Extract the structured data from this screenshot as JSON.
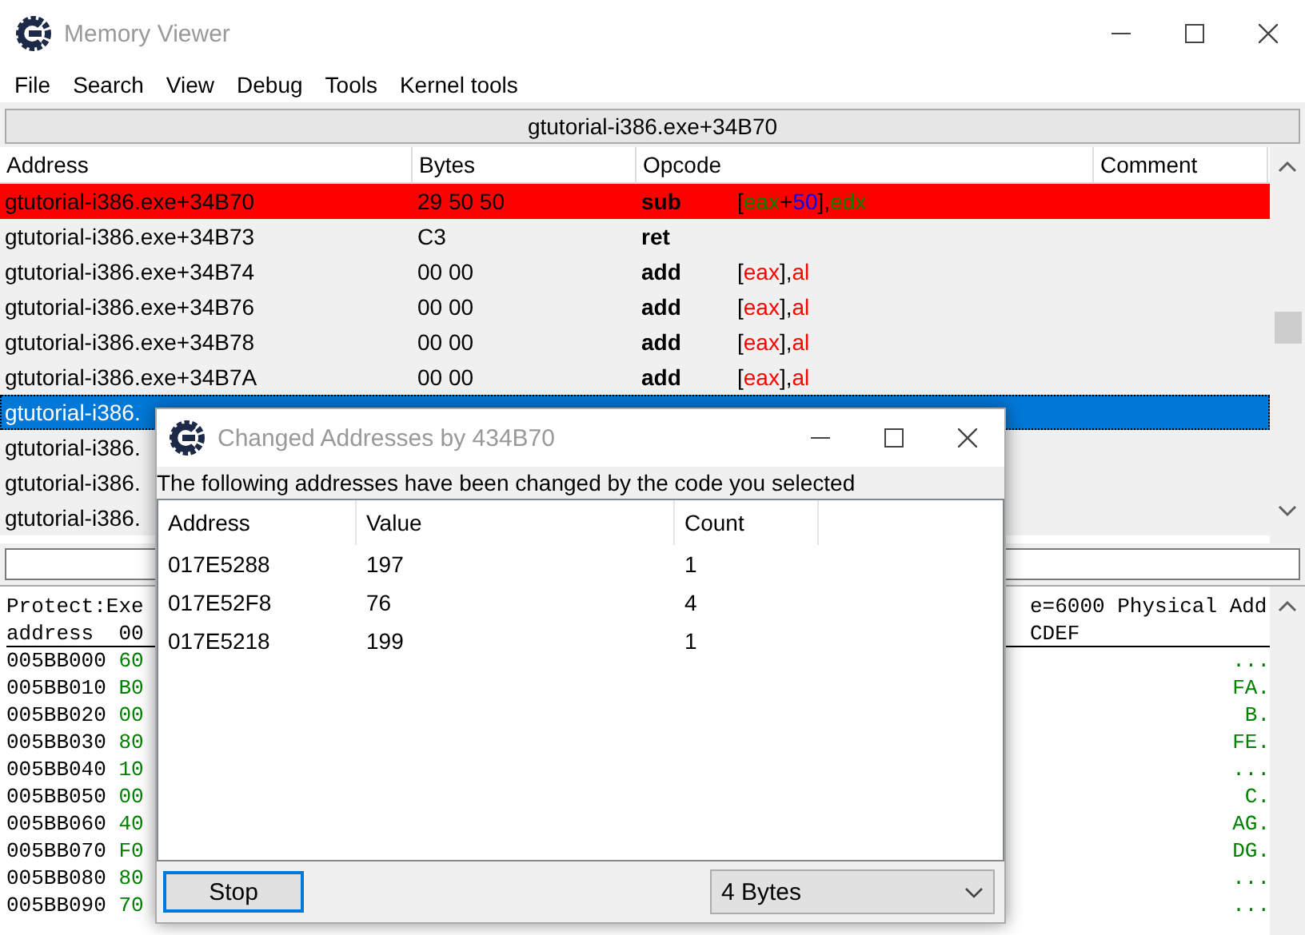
{
  "window": {
    "title": "Memory Viewer"
  },
  "menu": [
    "File",
    "Search",
    "View",
    "Debug",
    "Tools",
    "Kernel tools"
  ],
  "address_bar": "gtutorial-i386.exe+34B70",
  "disassembly": {
    "columns": [
      "Address",
      "Bytes",
      "Opcode",
      "Comment"
    ],
    "rows": [
      {
        "address": "gtutorial-i386.exe+34B70",
        "bytes": "29 50 50",
        "opcode": "sub",
        "operand": [
          {
            "text": "[",
            "color": "#000000"
          },
          {
            "text": "eax",
            "color": "#008000"
          },
          {
            "text": "+",
            "color": "#000000"
          },
          {
            "text": "50",
            "color": "#0000ff"
          },
          {
            "text": "],",
            "color": "#000000"
          },
          {
            "text": "edx",
            "color": "#008000"
          }
        ],
        "breakpoint": true,
        "selected": false
      },
      {
        "address": "gtutorial-i386.exe+34B73",
        "bytes": "C3",
        "opcode": "ret",
        "operand": [],
        "breakpoint": false,
        "selected": false
      },
      {
        "address": "gtutorial-i386.exe+34B74",
        "bytes": "00 00",
        "opcode": "add",
        "operand": [
          {
            "text": "[",
            "color": "#000000"
          },
          {
            "text": "eax",
            "color": "#ff0000"
          },
          {
            "text": "],",
            "color": "#000000"
          },
          {
            "text": "al",
            "color": "#ff0000"
          }
        ],
        "breakpoint": false,
        "selected": false
      },
      {
        "address": "gtutorial-i386.exe+34B76",
        "bytes": "00 00",
        "opcode": "add",
        "operand": [
          {
            "text": "[",
            "color": "#000000"
          },
          {
            "text": "eax",
            "color": "#ff0000"
          },
          {
            "text": "],",
            "color": "#000000"
          },
          {
            "text": "al",
            "color": "#ff0000"
          }
        ],
        "breakpoint": false,
        "selected": false
      },
      {
        "address": "gtutorial-i386.exe+34B78",
        "bytes": "00 00",
        "opcode": "add",
        "operand": [
          {
            "text": "[",
            "color": "#000000"
          },
          {
            "text": "eax",
            "color": "#ff0000"
          },
          {
            "text": "],",
            "color": "#000000"
          },
          {
            "text": "al",
            "color": "#ff0000"
          }
        ],
        "breakpoint": false,
        "selected": false
      },
      {
        "address": "gtutorial-i386.exe+34B7A",
        "bytes": "00 00",
        "opcode": "add",
        "operand": [
          {
            "text": "[",
            "color": "#000000"
          },
          {
            "text": "eax",
            "color": "#ff0000"
          },
          {
            "text": "],",
            "color": "#000000"
          },
          {
            "text": "al",
            "color": "#ff0000"
          }
        ],
        "breakpoint": false,
        "selected": false
      },
      {
        "address": "gtutorial-i386.",
        "breakpoint": false,
        "selected": true
      },
      {
        "address": "gtutorial-i386.",
        "breakpoint": false,
        "selected": false
      },
      {
        "address": "gtutorial-i386.",
        "breakpoint": false,
        "selected": false
      },
      {
        "address": "gtutorial-i386.",
        "breakpoint": false,
        "selected": false
      }
    ]
  },
  "hex_view": {
    "info_left": "Protect:Exe",
    "info_right": "e=6000 Physical Add",
    "header_left": "address  00",
    "header_right": "CDEF",
    "rows": [
      {
        "address": "005BB000",
        "bytes": "60",
        "text": "..."
      },
      {
        "address": "005BB010",
        "bytes": "B0",
        "text": "FA."
      },
      {
        "address": "005BB020",
        "bytes": "00",
        "text": "B."
      },
      {
        "address": "005BB030",
        "bytes": "80",
        "text": "FE."
      },
      {
        "address": "005BB040",
        "bytes": "10",
        "text": "..."
      },
      {
        "address": "005BB050",
        "bytes": "00",
        "text": "C."
      },
      {
        "address": "005BB060",
        "bytes": "40",
        "text": "AG."
      },
      {
        "address": "005BB070",
        "bytes": "F0",
        "text": "DG."
      },
      {
        "address": "005BB080",
        "bytes": "80",
        "text": "..."
      },
      {
        "address": "005BB090",
        "bytes": "70",
        "text": "..."
      }
    ]
  },
  "dialog": {
    "title": "Changed Addresses by 434B70",
    "message": "The following addresses have been changed by the code you selected",
    "columns": [
      "Address",
      "Value",
      "Count"
    ],
    "rows": [
      [
        "017E5288",
        "197",
        "1"
      ],
      [
        "017E52F8",
        "76",
        "4"
      ],
      [
        "017E5218",
        "199",
        "1"
      ]
    ],
    "stop_button": "Stop",
    "size_select": "4 Bytes"
  }
}
